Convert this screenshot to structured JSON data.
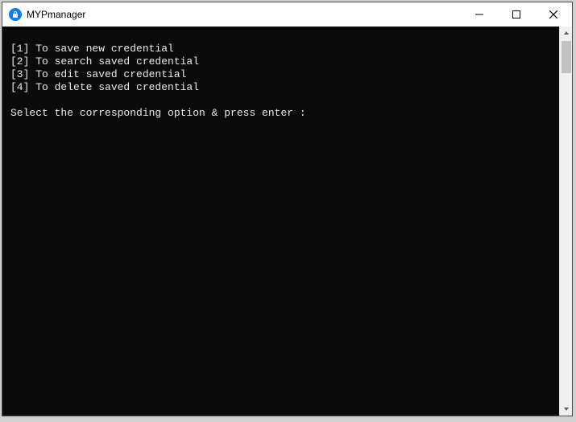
{
  "window": {
    "title": "MYPmanager"
  },
  "terminal": {
    "menu": [
      "[1] To save new credential",
      "[2] To search saved credential",
      "[3] To edit saved credential",
      "[4] To delete saved credential"
    ],
    "prompt": "Select the corresponding option & press enter :"
  }
}
